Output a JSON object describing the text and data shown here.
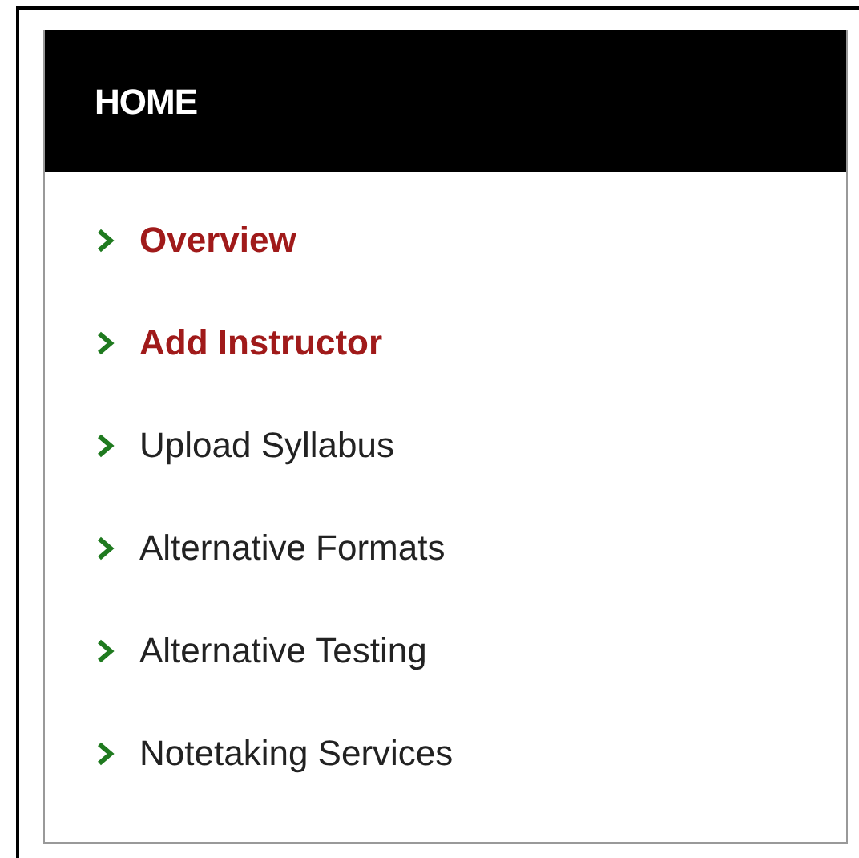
{
  "menu": {
    "title": "HOME",
    "items": [
      {
        "label": "Overview",
        "selected": true
      },
      {
        "label": "Add Instructor",
        "selected": true
      },
      {
        "label": "Upload Syllabus",
        "selected": false
      },
      {
        "label": "Alternative Formats",
        "selected": false
      },
      {
        "label": "Alternative Testing",
        "selected": false
      },
      {
        "label": "Notetaking Services",
        "selected": false
      }
    ]
  }
}
